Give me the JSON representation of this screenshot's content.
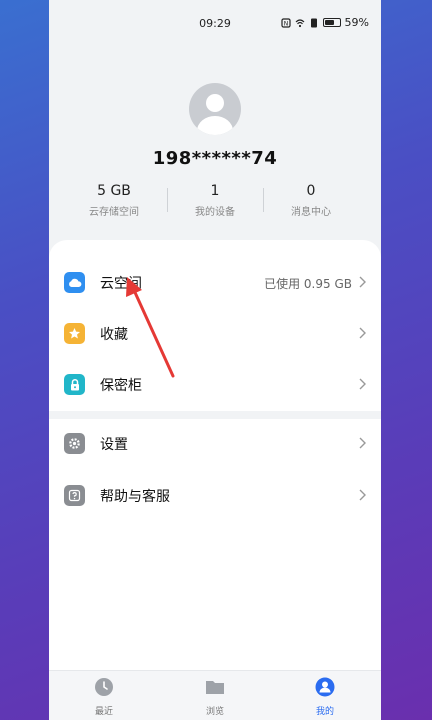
{
  "status_bar": {
    "time": "09:29",
    "battery": "59%"
  },
  "profile": {
    "username": "198******74",
    "stats": [
      {
        "value": "5 GB",
        "label": "云存储空间"
      },
      {
        "value": "1",
        "label": "我的设备"
      },
      {
        "value": "0",
        "label": "消息中心"
      }
    ]
  },
  "menu": {
    "group1": [
      {
        "label": "云空间",
        "extra": "已使用 0.95 GB",
        "icon": "cloud-icon",
        "color": "#2f8ff0"
      },
      {
        "label": "收藏",
        "extra": "",
        "icon": "star-icon",
        "color": "#f5b335"
      },
      {
        "label": "保密柜",
        "extra": "",
        "icon": "lock-icon",
        "color": "#21b6c9"
      }
    ],
    "group2": [
      {
        "label": "设置",
        "icon": "gear-icon",
        "color": "#8a8d92"
      },
      {
        "label": "帮助与客服",
        "icon": "help-icon",
        "color": "#8a8d92"
      }
    ]
  },
  "annotation": {
    "color": "#e53935"
  },
  "tabs": [
    {
      "label": "最近",
      "icon": "clock-icon",
      "active": false
    },
    {
      "label": "浏览",
      "icon": "folder-icon",
      "active": false
    },
    {
      "label": "我的",
      "icon": "profile-icon",
      "active": true
    }
  ],
  "colors": {
    "accent": "#2b6cf0",
    "background": "#f1f3f5"
  }
}
